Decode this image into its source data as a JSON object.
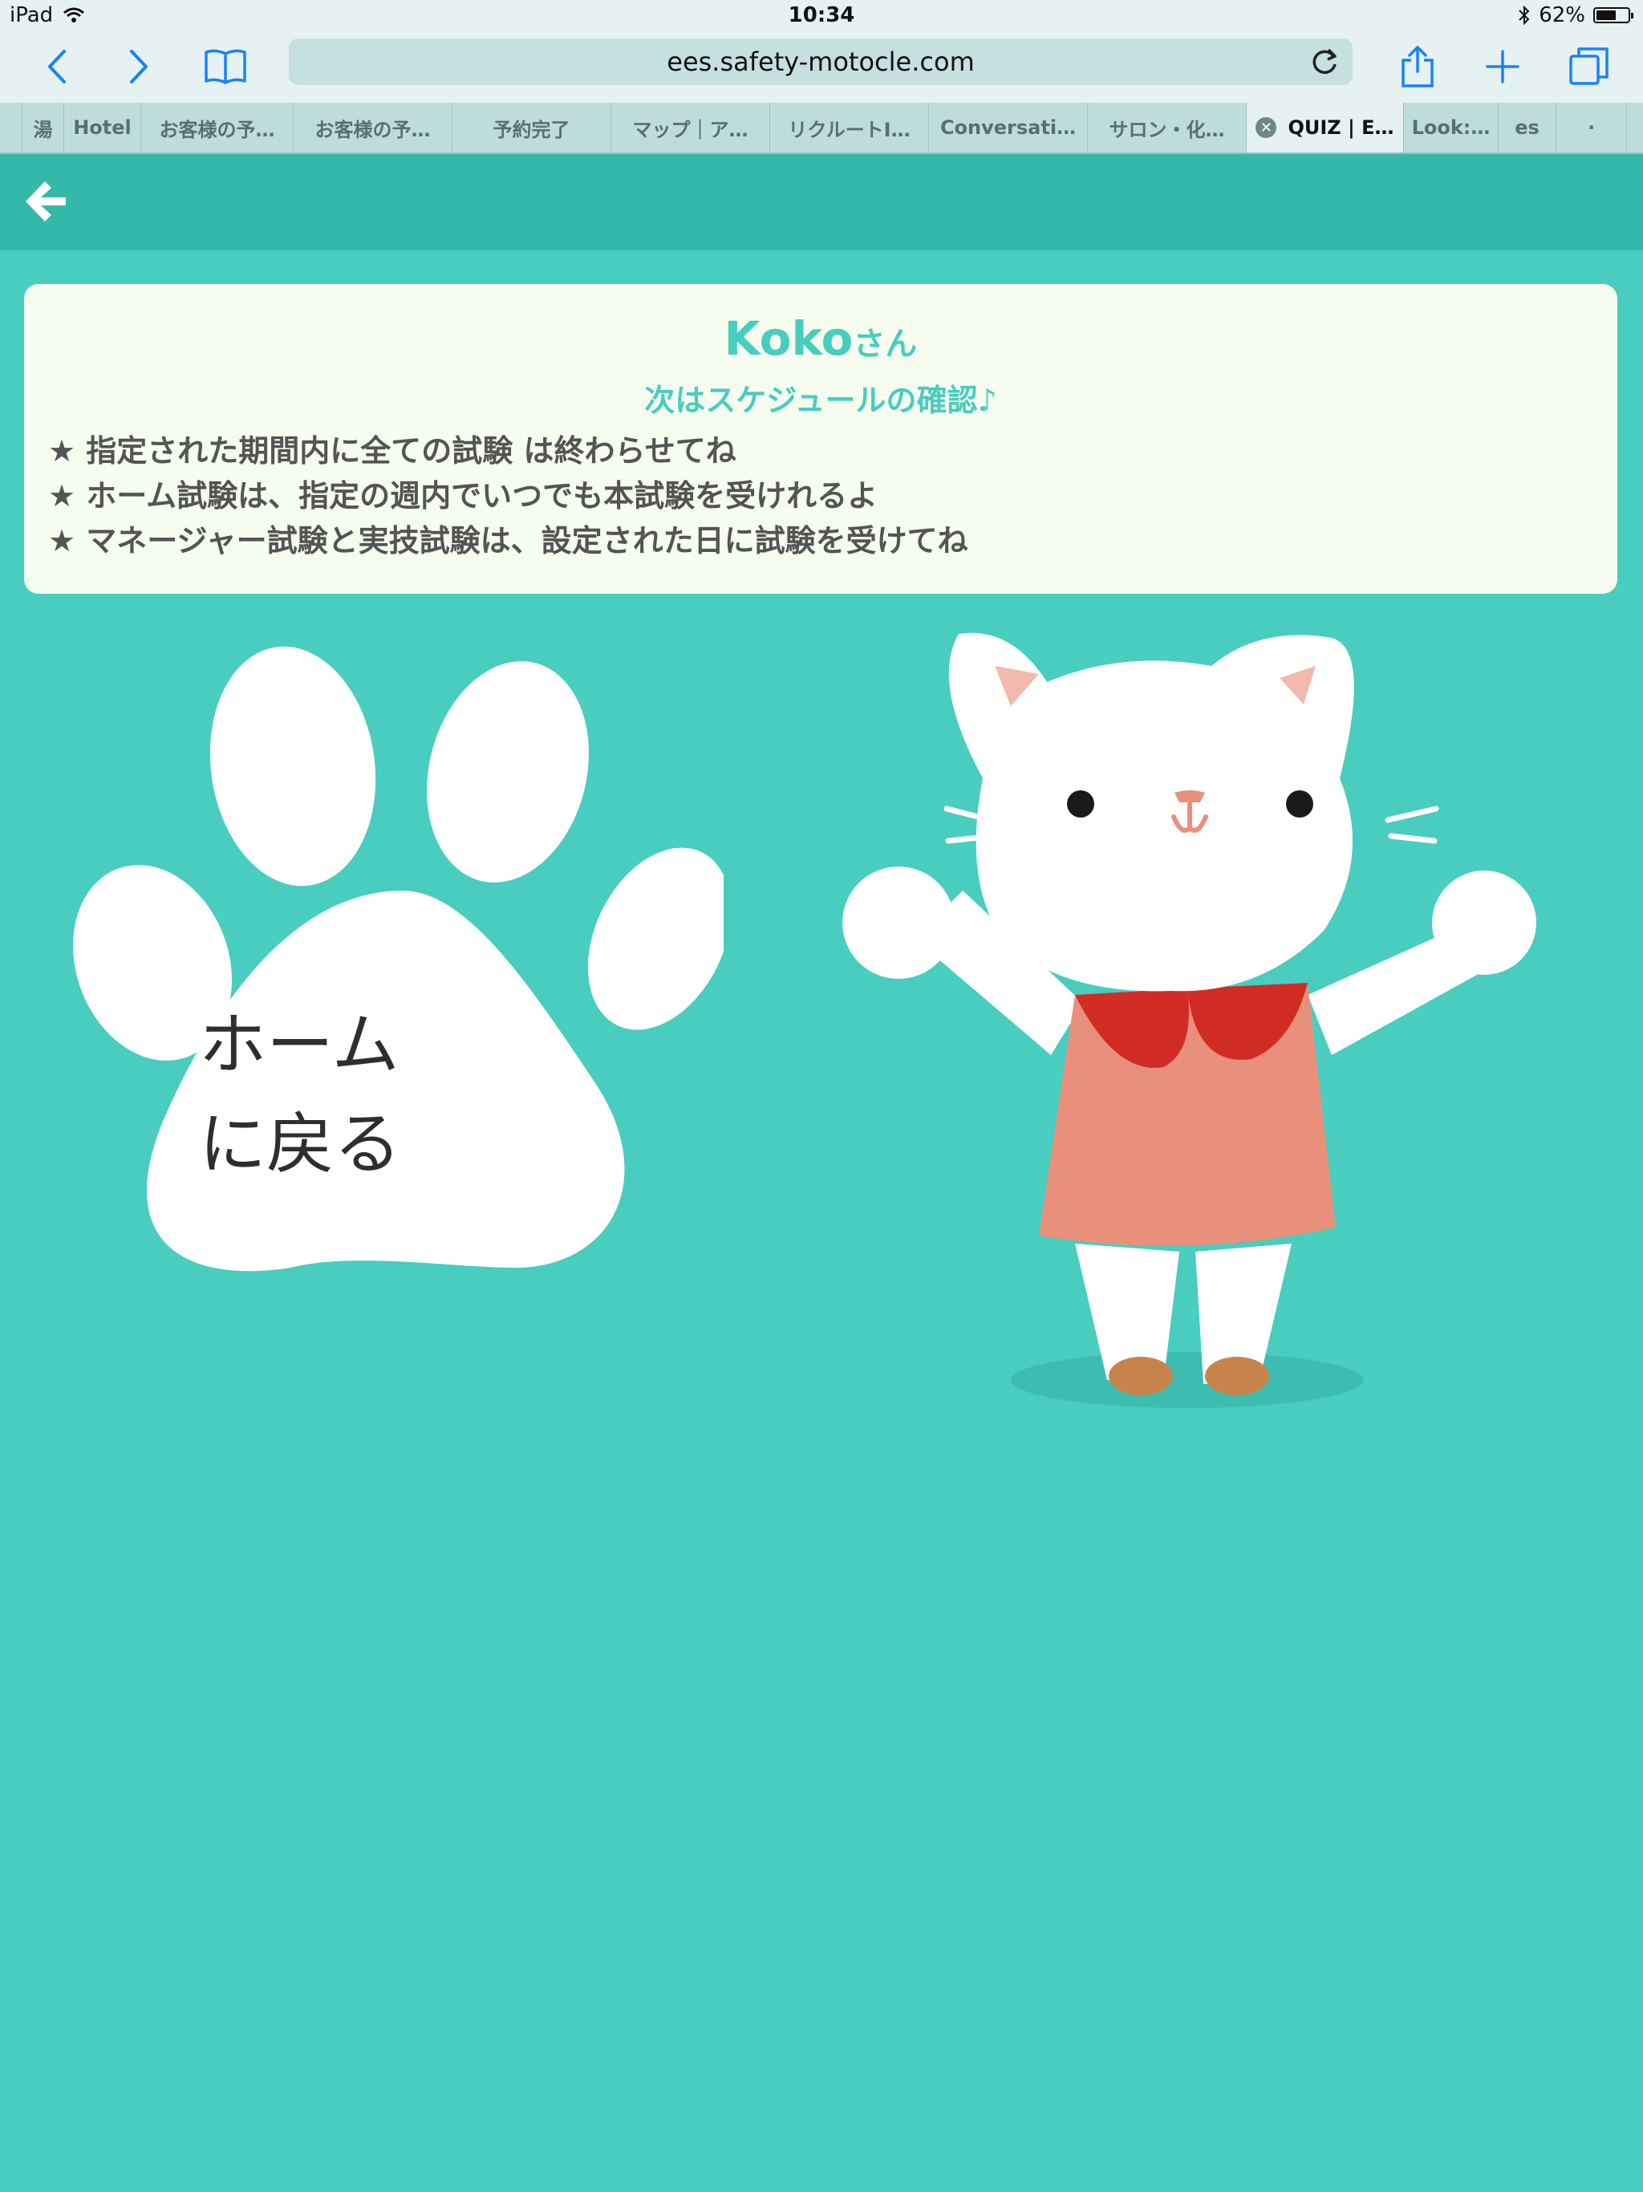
{
  "status_bar": {
    "device": "iPad",
    "time": "10:34",
    "battery": "62%",
    "battery_level": 0.62
  },
  "browser": {
    "url": "ees.safety-motocle.com",
    "tabs": [
      {
        "label": ""
      },
      {
        "label": "湯"
      },
      {
        "label": "Hotel"
      },
      {
        "label": "お客様の予…"
      },
      {
        "label": "お客様の予…"
      },
      {
        "label": "予約完了"
      },
      {
        "label": "マップ｜ア…"
      },
      {
        "label": "リクルートI…"
      },
      {
        "label": "Conversati…"
      },
      {
        "label": "サロン・化…"
      },
      {
        "label": "QUIZ | E…",
        "active": true
      },
      {
        "label": "Look:…"
      },
      {
        "label": "es"
      },
      {
        "label": "·"
      }
    ]
  },
  "card": {
    "name": "Koko",
    "honorific": "さん",
    "subtitle": "次はスケジュールの確認♪",
    "rules": [
      "★ 指定された期間内に全ての試験 は終わらせてね",
      "★ ホーム試験は、指定の週内でいつでも本試験を受けれるよ",
      "★ マネージャー試験と実技試験は、設定された日に試験を受けてね"
    ]
  },
  "paw_button": {
    "line1": "ホーム",
    "line2": "に戻る"
  },
  "colors": {
    "page_bg": "#48cdbf",
    "header_bg": "#34b8a9",
    "card_bg": "#f6fdef",
    "accent_text": "#48cdbf",
    "body_text": "#545454",
    "ios_blue": "#1a82f7"
  }
}
